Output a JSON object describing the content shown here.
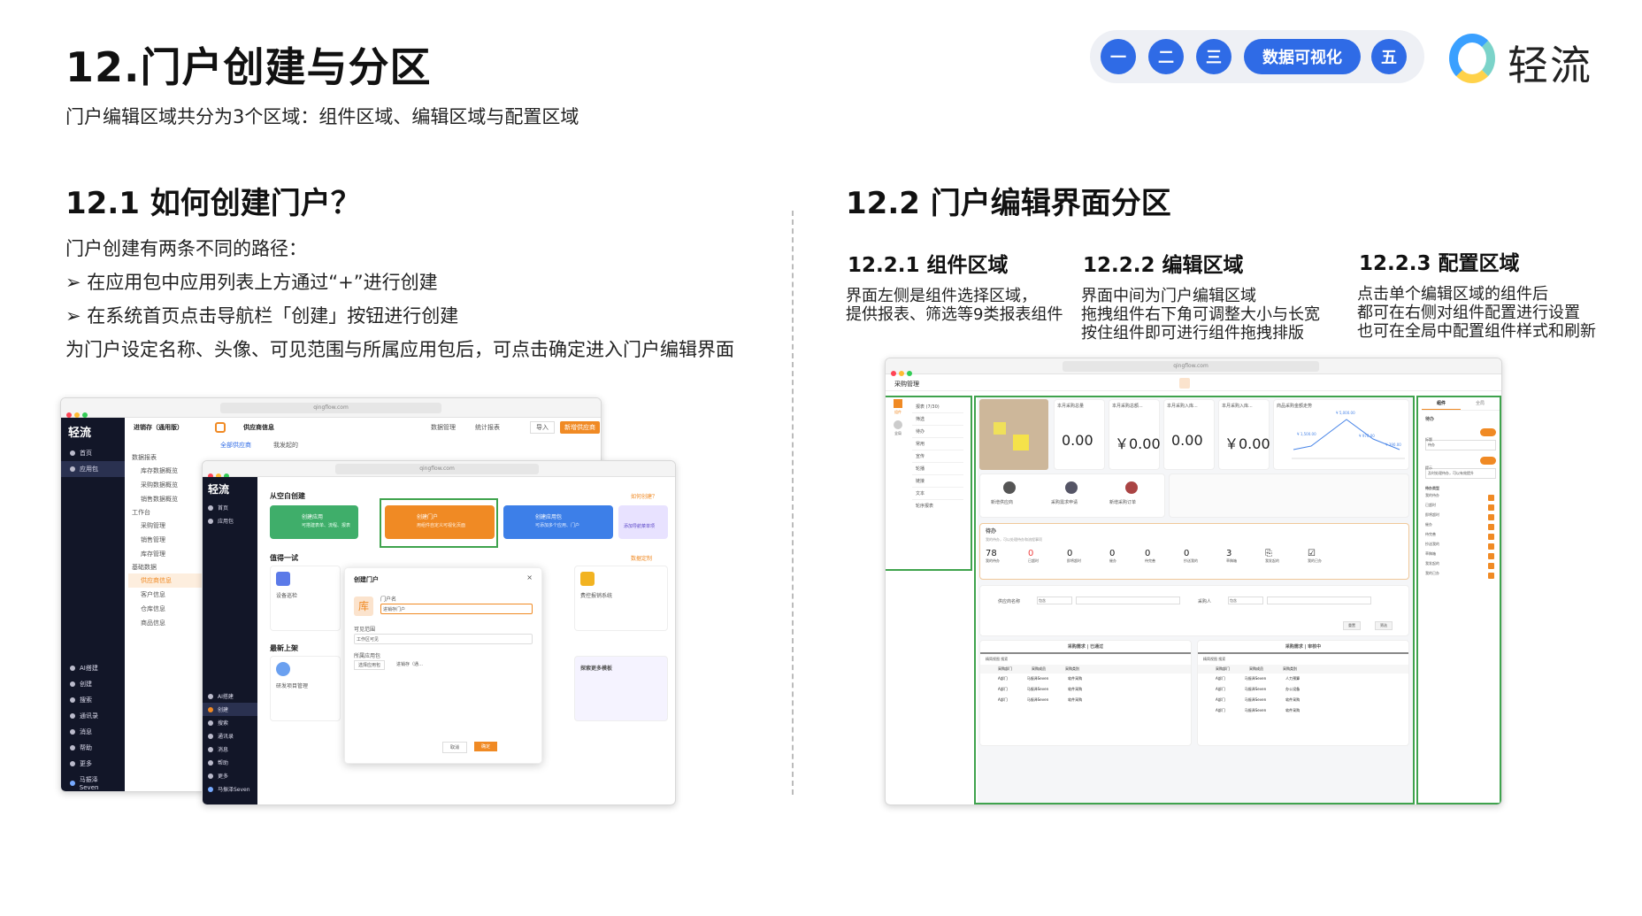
{
  "header": {
    "title": "12.门户创建与分区",
    "subtitle": "门户编辑区域共分为3个区域：组件区域、编辑区域与配置区域",
    "nav": [
      "一",
      "二",
      "三",
      "数据可视化",
      "五"
    ],
    "logo_text": "轻流"
  },
  "left": {
    "heading": "12.1 如何创建门户？",
    "intro": "门户创建有两条不同的路径：",
    "bullet1": "➢  在应用包中应用列表上方通过“+”进行创建",
    "bullet2": "➢  在系统首页点击导航栏「创建」按钮进行创建",
    "outro": "为门户设定名称、头像、可见范围与所属应用包后，可点击确定进入门户编辑界面"
  },
  "right": {
    "heading": "12.2 门户编辑界面分区",
    "sections": [
      {
        "title": "12.2.1 组件区域",
        "lines": [
          "界面左侧是组件选择区域，",
          "提供报表、筛选等9类报表组件"
        ]
      },
      {
        "title": "12.2.2 编辑区域",
        "lines": [
          "界面中间为门户编辑区域",
          "拖拽组件右下角可调整大小与长宽",
          "按住组件即可进行组件拖拽排版"
        ]
      },
      {
        "title": "12.2.3 配置区域",
        "lines": [
          "点击单个编辑区域的组件后",
          "都可在右侧对组件配置进行设置",
          "也可在全局中配置组件样式和刷新"
        ]
      }
    ]
  },
  "shot1": {
    "url": "qingflow.com",
    "logo": "轻流",
    "side_items": [
      "首页",
      "应用包"
    ],
    "side_bottom": [
      "AI搭建",
      "创建",
      "搜索",
      "通讯录",
      "消息",
      "帮助",
      "更多",
      "马振泽Seven"
    ],
    "app_name": "进销存（通用版）",
    "tab": "供应商信息",
    "tree": [
      "数据报表",
      "库存数据概览",
      "采购数据概览",
      "销售数据概览",
      "工作台",
      "采购管理",
      "销售管理",
      "库存管理",
      "基础数据",
      "供应商信息",
      "客户信息",
      "仓库信息",
      "商品信息"
    ],
    "toolbar": [
      "数据管理",
      "统计报表",
      "导入",
      "新增供应商"
    ],
    "filters": [
      "全部供应商",
      "我发起的"
    ]
  },
  "shot2": {
    "url": "qingflow.com",
    "logo": "轻流",
    "side_items": [
      "首页",
      "应用包"
    ],
    "side_bottom": [
      "AI搭建",
      "创建",
      "搜索",
      "通讯录",
      "消息",
      "帮助",
      "更多",
      "马振泽Seven"
    ],
    "section1": "从空白创建",
    "link1": "如何创建？",
    "create_cards": [
      {
        "title": "创建应用",
        "desc": "可搭建表单、流程、报表"
      },
      {
        "title": "创建门户",
        "desc": "用组件自定义可视化页面"
      },
      {
        "title": "创建应用包",
        "desc": "可添加多个应用、门户"
      },
      {
        "title": "添加导航菜单项",
        "desc": ""
      }
    ],
    "section2": "值得一试",
    "link2": "数据定制",
    "try_cards": [
      "设备巡检",
      "费控报销系统"
    ],
    "section3": "最新上架",
    "new_cards": [
      "研发项目管理",
      "探索更多模板"
    ],
    "dialog": {
      "title": "创建门户",
      "name_label": "门户名",
      "name_value": "进销存门户",
      "avatar": "库",
      "scope_label": "可见范围",
      "scope_value": "工作区可见",
      "pkg_label": "所属应用包",
      "pkg_btn": "选择应用包",
      "pkg_value": "进销存（通…",
      "cancel": "取消",
      "ok": "确定"
    }
  },
  "shot3": {
    "url": "qingflow.com",
    "page_title": "采购管理",
    "left_tabs": [
      "组件",
      "全局"
    ],
    "widgets": [
      "报表 (7/30)",
      "筛选",
      "待办",
      "常用",
      "宣传",
      "轮播",
      "链接",
      "文本",
      "轮序报表"
    ],
    "stats": [
      {
        "label": "本月采购总量",
        "value": "0.00"
      },
      {
        "label": "本月采购总额...",
        "value": "￥0.00"
      },
      {
        "label": "本月采购入库...",
        "value": "0.00"
      },
      {
        "label": "本月采购入库...",
        "value": "￥0.00"
      }
    ],
    "trend_title": "商品采购金额走势",
    "trend_labels": [
      "¥ 5,000.00",
      "¥ 1,500.00",
      "¥ 970.00",
      "¥ 390.00"
    ],
    "shortcuts": [
      "新增供应商",
      "采购需求申请",
      "新增采购订单"
    ],
    "todo_title": "待办",
    "todo_hint": "我的待办，可以处理待办和流程事项",
    "todo_stats": [
      {
        "n": "78",
        "l": "我的待办"
      },
      {
        "n": "0",
        "l": "已超时"
      },
      {
        "n": "0",
        "l": "即将超时"
      },
      {
        "n": "0",
        "l": "催办"
      },
      {
        "n": "0",
        "l": "待完善"
      },
      {
        "n": "0",
        "l": "抄送我的"
      },
      {
        "n": "3",
        "l": "草稿箱"
      }
    ],
    "todo_icons": [
      "我发起的",
      "我的已办"
    ],
    "filter_fields": [
      "供应商名称",
      "包含",
      "采购人",
      "包含"
    ],
    "filter_btns": [
      "重置",
      "筛选"
    ],
    "table1_title": "采购需求 | 已通过",
    "table2_title": "采购需求 | 审核中",
    "table_tools": [
      "精简视图",
      "搜索"
    ],
    "table_cols": [
      "采购部门",
      "采购成员",
      "采购类别"
    ],
    "table1_rows": [
      [
        "A部门",
        "马振泽Seven",
        "软件采购"
      ],
      [
        "A部门",
        "马振泽Seven",
        "软件采购"
      ],
      [
        "A部门",
        "马振泽Seven",
        "软件采购"
      ]
    ],
    "table2_rows": [
      [
        "A部门",
        "马振泽Seven",
        "人力预算"
      ],
      [
        "A部门",
        "马振泽Seven",
        "办公设备"
      ],
      [
        "A部门",
        "马振泽Seven",
        "软件采购"
      ],
      [
        "A部门",
        "马振泽Seven",
        "软件采购"
      ]
    ],
    "config_tabs": [
      "组件",
      "全局"
    ],
    "config_title": "待办",
    "config_items": [
      "标题",
      "待办",
      "提示",
      "及时处理待办，可以有效提升",
      "待办类型"
    ],
    "config_types": [
      "我的待办",
      "已超时",
      "即将超时",
      "催办",
      "待完善",
      "抄送我的",
      "草稿箱",
      "我发起的",
      "我的已办"
    ],
    "colors": {
      "accent": "#f08a24",
      "green": "#3fa34d",
      "blue": "#2f6be6"
    }
  }
}
